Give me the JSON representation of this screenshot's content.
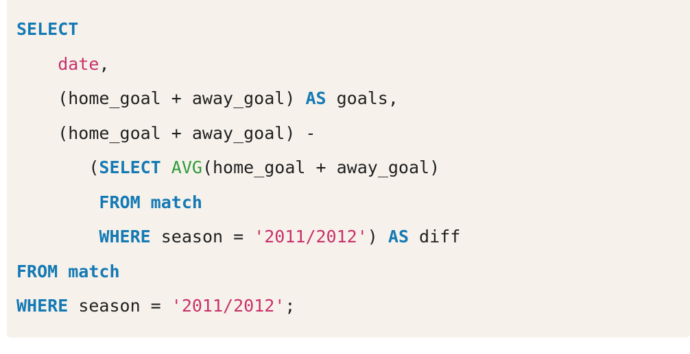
{
  "code": {
    "lines": [
      {
        "tokens": [
          {
            "t": "SELECT",
            "k": "kw"
          }
        ]
      },
      {
        "tokens": [
          {
            "t": "    ",
            "k": "tx"
          },
          {
            "t": "date",
            "k": "id"
          },
          {
            "t": ",",
            "k": "tx"
          }
        ]
      },
      {
        "tokens": [
          {
            "t": "    (home_goal + away_goal) ",
            "k": "tx"
          },
          {
            "t": "AS",
            "k": "kw"
          },
          {
            "t": " goals,",
            "k": "tx"
          }
        ]
      },
      {
        "tokens": [
          {
            "t": "    (home_goal + away_goal) -",
            "k": "tx"
          }
        ]
      },
      {
        "tokens": [
          {
            "t": "       (",
            "k": "tx"
          },
          {
            "t": "SELECT",
            "k": "kw"
          },
          {
            "t": " ",
            "k": "tx"
          },
          {
            "t": "AVG",
            "k": "fn"
          },
          {
            "t": "(home_goal + away_goal)",
            "k": "tx"
          }
        ]
      },
      {
        "tokens": [
          {
            "t": "        ",
            "k": "tx"
          },
          {
            "t": "FROM match",
            "k": "kw"
          }
        ]
      },
      {
        "tokens": [
          {
            "t": "        ",
            "k": "tx"
          },
          {
            "t": "WHERE",
            "k": "kw"
          },
          {
            "t": " season = ",
            "k": "tx"
          },
          {
            "t": "'2011/2012'",
            "k": "str"
          },
          {
            "t": ") ",
            "k": "tx"
          },
          {
            "t": "AS",
            "k": "kw"
          },
          {
            "t": " diff",
            "k": "tx"
          }
        ]
      },
      {
        "tokens": [
          {
            "t": "FROM match",
            "k": "kw"
          }
        ]
      },
      {
        "tokens": [
          {
            "t": "WHERE",
            "k": "kw"
          },
          {
            "t": " season = ",
            "k": "tx"
          },
          {
            "t": "'2011/2012'",
            "k": "str"
          },
          {
            "t": ";",
            "k": "tx"
          }
        ]
      }
    ]
  }
}
